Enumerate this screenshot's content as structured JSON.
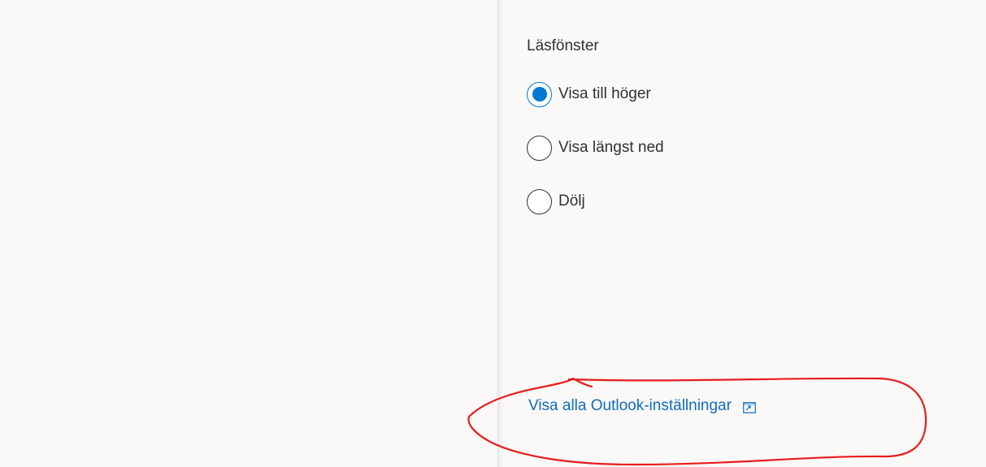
{
  "reading_pane": {
    "title": "Läsfönster",
    "options": [
      {
        "label": "Visa till höger",
        "checked": true
      },
      {
        "label": "Visa längst ned",
        "checked": false
      },
      {
        "label": "Dölj",
        "checked": false
      }
    ]
  },
  "footer": {
    "link_label": "Visa alla Outlook-inställningar",
    "link_icon": "open-external-icon"
  },
  "colors": {
    "accent": "#0078d4",
    "link": "#0f6cbd",
    "background": "#faf9f8",
    "annotation": "#e81c1c"
  }
}
